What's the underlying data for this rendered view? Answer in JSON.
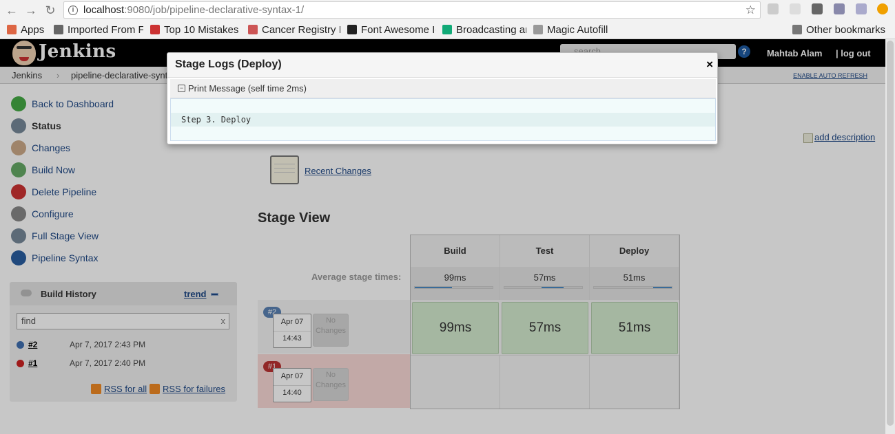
{
  "browser": {
    "url_host": "localhost",
    "url_path": ":9080/job/pipeline-declarative-syntax-1/",
    "bookmarks": [
      {
        "label": "Apps",
        "color": "#d64"
      },
      {
        "label": "Imported From F",
        "color": "#666"
      },
      {
        "label": "Top 10 Mistakes I",
        "color": "#c33"
      },
      {
        "label": "Cancer Registry F",
        "color": "#c55"
      },
      {
        "label": "Font Awesome Ic",
        "color": "#222"
      },
      {
        "label": "Broadcasting an",
        "color": "#1a7"
      },
      {
        "label": "Magic Autofill",
        "color": "#999"
      }
    ],
    "other_bookmarks": "Other bookmarks"
  },
  "header": {
    "title": "Jenkins",
    "search_placeholder": "search",
    "help": "?",
    "user": "Mahtab Alam",
    "logout": "| log out"
  },
  "breadcrumb": {
    "items": [
      "Jenkins",
      "pipeline-declarative-synt"
    ],
    "auto_refresh": "ENABLE AUTO REFRESH"
  },
  "sidebar": {
    "tasks": [
      {
        "label": "Back to Dashboard",
        "icon": "arrow-up-icon",
        "color": "#4a4"
      },
      {
        "label": "Status",
        "icon": "magnifier-icon",
        "color": "#789"
      },
      {
        "label": "Changes",
        "icon": "notepad-icon",
        "color": "#ca8"
      },
      {
        "label": "Build Now",
        "icon": "clock-icon",
        "color": "#6a6"
      },
      {
        "label": "Delete Pipeline",
        "icon": "no-entry-icon",
        "color": "#c33"
      },
      {
        "label": "Configure",
        "icon": "gear-icon",
        "color": "#888"
      },
      {
        "label": "Full Stage View",
        "icon": "magnifier-icon",
        "color": "#789"
      },
      {
        "label": "Pipeline Syntax",
        "icon": "help-icon",
        "color": "#2a5ea0"
      }
    ]
  },
  "build_history": {
    "title": "Build History",
    "trend": "trend",
    "find": "find",
    "clear": "x",
    "builds": [
      {
        "num": "#2",
        "date": "Apr 7, 2017 2:43 PM",
        "color": "#3f6fb0"
      },
      {
        "num": "#1",
        "date": "Apr 7, 2017 2:40 PM",
        "color": "#c22"
      }
    ],
    "rss_all": "RSS for all",
    "rss_failures": "RSS for failures"
  },
  "main": {
    "add_description": "add description",
    "recent_changes": "Recent Changes",
    "stage_view_title": "Stage View",
    "avg_label": "Average stage times:",
    "stages": [
      {
        "name": "Build",
        "avg": "99ms",
        "bar_start": 0.0,
        "bar_fraction": 0.48
      },
      {
        "name": "Test",
        "avg": "57ms",
        "bar_start": 0.48,
        "bar_fraction": 0.28
      },
      {
        "name": "Deploy",
        "avg": "51ms",
        "bar_start": 0.76,
        "bar_fraction": 0.24
      }
    ],
    "runs": [
      {
        "badge": "#2",
        "badge_color": "#5a82b4",
        "date": "Apr 07",
        "time": "14:43",
        "no_changes": "No Changes",
        "row_color": "#f4f4f4",
        "cells": [
          "99ms",
          "57ms",
          "51ms"
        ]
      },
      {
        "badge": "#1",
        "badge_color": "#b33",
        "date": "Apr 07",
        "time": "14:40",
        "no_changes": "No Changes",
        "row_color": "#f9d9d6",
        "cells": []
      }
    ]
  },
  "modal": {
    "title": "Stage Logs (Deploy)",
    "close": "×",
    "step_toggle": "−",
    "step_label": "Print Message (self time 2ms)",
    "log_line": "Step 3. Deploy"
  }
}
